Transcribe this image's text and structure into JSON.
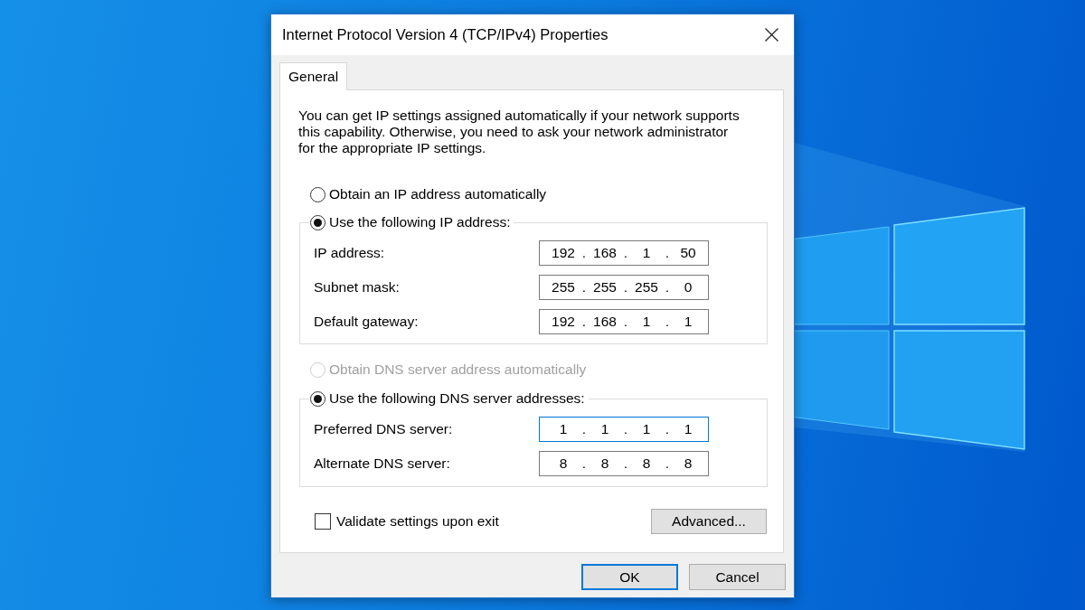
{
  "window": {
    "title": "Internet Protocol Version 4 (TCP/IPv4) Properties"
  },
  "tabs": [
    {
      "label": "General",
      "selected": true
    }
  ],
  "description": "You can get IP settings assigned automatically if your network supports this capability. Otherwise, you need to ask your network administrator for the appropriate IP settings.",
  "ip_settings": [
    {
      "kind": "option",
      "label": "Obtain an IP address automatically",
      "selected": false,
      "disabled": false
    },
    {
      "kind": "group",
      "label": "Use the following IP address:",
      "selected": true,
      "disabled": false,
      "fields": [
        {
          "label": "IP address:",
          "segments": [
            "192",
            ".",
            "168",
            ".",
            "1",
            ".",
            "50"
          ],
          "focused": false
        },
        {
          "label": "Subnet mask:",
          "segments": [
            "255",
            ".",
            "255",
            ".",
            "255",
            ".",
            "0"
          ],
          "focused": false
        },
        {
          "label": "Default gateway:",
          "segments": [
            "192",
            ".",
            "168",
            ".",
            "1",
            ".",
            "1"
          ],
          "focused": false
        }
      ]
    }
  ],
  "dns_settings": [
    {
      "kind": "option",
      "label": "Obtain DNS server address automatically",
      "selected": false,
      "disabled": true
    },
    {
      "kind": "group",
      "label": "Use the following DNS server addresses:",
      "selected": true,
      "disabled": false,
      "fields": [
        {
          "label": "Preferred DNS server:",
          "segments": [
            "1",
            ".",
            "1",
            ".",
            "1",
            ".",
            "1"
          ],
          "focused": true
        },
        {
          "label": "Alternate DNS server:",
          "segments": [
            "8",
            ".",
            "8",
            ".",
            "8",
            ".",
            "8"
          ],
          "focused": false
        }
      ]
    }
  ],
  "validate_option": {
    "label": "Validate settings upon exit",
    "checked": false
  },
  "advanced_button": {
    "label": "Advanced..."
  },
  "dialog_buttons": [
    {
      "label": "OK",
      "default": true
    },
    {
      "label": "Cancel",
      "default": false
    }
  ]
}
